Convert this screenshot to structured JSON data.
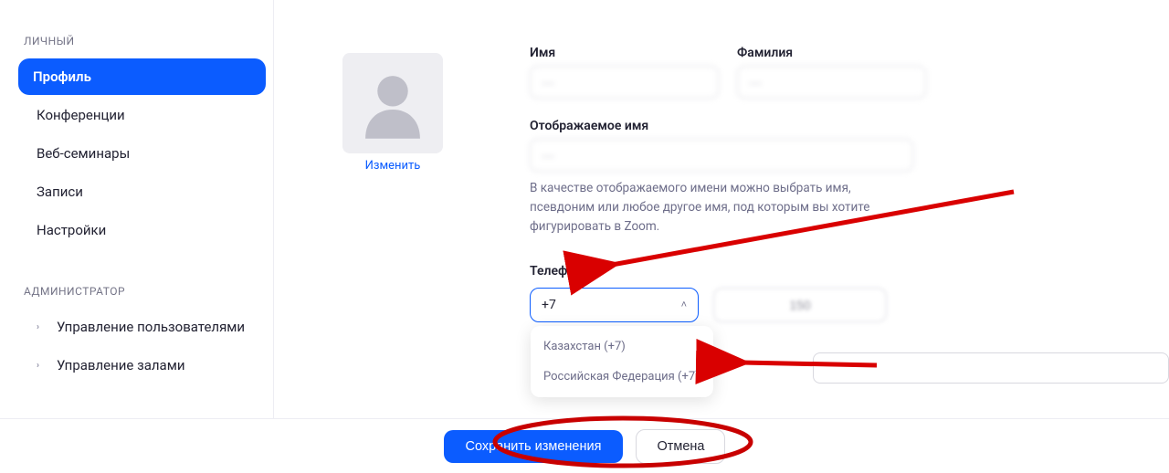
{
  "sidebar": {
    "section_personal": "ЛИЧНЫЙ",
    "section_admin": "АДМИНИСТРАТОР",
    "items_personal": [
      {
        "label": "Профиль",
        "active": true
      },
      {
        "label": "Конференции"
      },
      {
        "label": "Веб-семинары"
      },
      {
        "label": "Записи"
      },
      {
        "label": "Настройки"
      }
    ],
    "items_admin": [
      {
        "label": "Управление пользователями"
      },
      {
        "label": "Управление залами"
      }
    ]
  },
  "avatar": {
    "change_label": "Изменить"
  },
  "form": {
    "first_name_label": "Имя",
    "first_name_value": "—",
    "last_name_label": "Фамилия",
    "last_name_value": "—",
    "display_name_label": "Отображаемое имя",
    "display_name_value": "—",
    "display_help": "В качестве отображаемого имени можно выбрать имя, псевдоним или любое другое имя, под которым вы хотите фигурировать в Zoom.",
    "phone_label": "Телефон",
    "country_value": "+7",
    "phone_value": "150",
    "dropdown": [
      "Казахстан (+7)",
      "Российская Федерация (+7)"
    ]
  },
  "footer": {
    "save": "Сохранить изменения",
    "cancel": "Отмена"
  }
}
